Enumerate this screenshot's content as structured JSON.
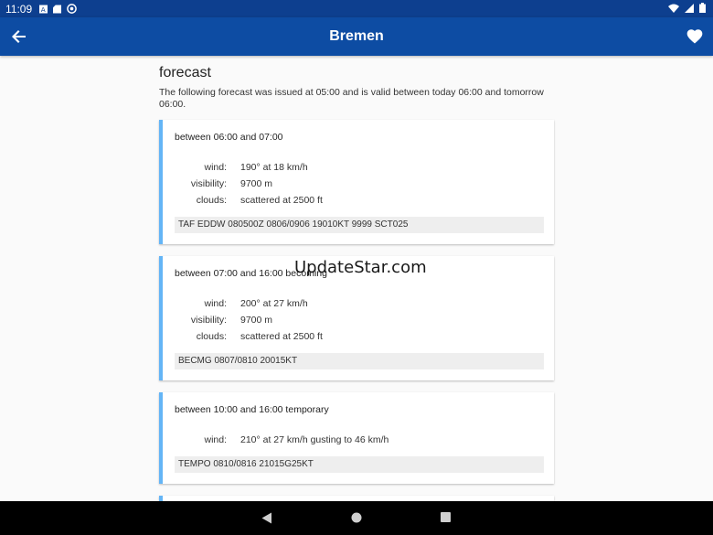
{
  "status_bar": {
    "time": "11:09",
    "icons_left": [
      "a-icon",
      "sd-card-icon",
      "sync-icon"
    ],
    "icons_right": [
      "wifi-icon",
      "signal-icon",
      "battery-icon"
    ]
  },
  "app_bar": {
    "title": "Bremen",
    "back_icon": "arrow-back-icon",
    "favorite_icon": "heart-icon",
    "color": "#0d4ca3"
  },
  "forecast": {
    "heading": "forecast",
    "intro": "The following forecast was issued at 05:00 and is valid between today 06:00 and tomorrow 06:00.",
    "accent_color": "#64b5f6",
    "cards": [
      {
        "period": "between 06:00 and 07:00",
        "rows": [
          {
            "label": "wind:",
            "value": "190° at 18 km/h"
          },
          {
            "label": "visibility:",
            "value": "9700 m"
          },
          {
            "label": "clouds:",
            "value": "scattered at 2500 ft"
          }
        ],
        "raw": "TAF EDDW 080500Z 0806/0906 19010KT 9999 SCT025"
      },
      {
        "period": "between 07:00 and 16:00 becoming",
        "rows": [
          {
            "label": "wind:",
            "value": "200° at 27 km/h"
          },
          {
            "label": "visibility:",
            "value": "9700 m"
          },
          {
            "label": "clouds:",
            "value": "scattered at 2500 ft"
          }
        ],
        "raw": "BECMG 0807/0810 20015KT"
      },
      {
        "period": "between 10:00 and 16:00 temporary",
        "rows": [
          {
            "label": "wind:",
            "value": "210° at 27 km/h gusting to 46 km/h"
          }
        ],
        "raw": "TEMPO 0810/0816 21015G25KT"
      }
    ]
  },
  "watermark": "UpdateStar.com",
  "nav_bar": {
    "buttons": [
      "back-triangle-icon",
      "home-circle-icon",
      "recents-square-icon"
    ]
  }
}
